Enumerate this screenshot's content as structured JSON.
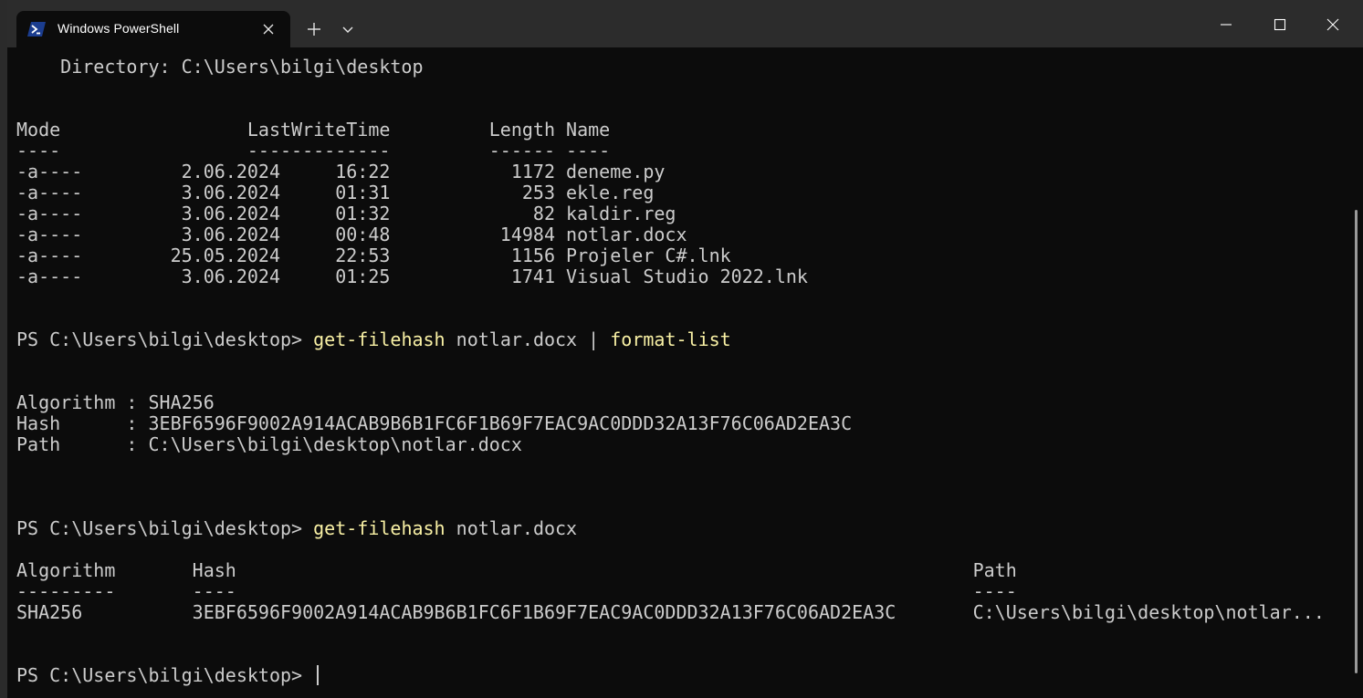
{
  "window": {
    "tab_title": "Windows PowerShell",
    "tab_icon": "powershell-icon",
    "colors": {
      "background": "#0c0c0c",
      "text": "#cccccc",
      "command_highlight": "#f9f1a5",
      "titlebar": "#2c2c2c",
      "icon_blue": "#1b3d8f"
    }
  },
  "terminal": {
    "lines": [
      {
        "t": "    Directory: C:\\Users\\bilgi\\desktop"
      },
      {
        "t": ""
      },
      {
        "t": ""
      },
      {
        "t": "Mode                 LastWriteTime         Length Name"
      },
      {
        "t": "----                 -------------         ------ ----"
      },
      {
        "t": "-a----         2.06.2024     16:22           1172 deneme.py"
      },
      {
        "t": "-a----         3.06.2024     01:31            253 ekle.reg"
      },
      {
        "t": "-a----         3.06.2024     01:32             82 kaldir.reg"
      },
      {
        "t": "-a----         3.06.2024     00:48          14984 notlar.docx"
      },
      {
        "t": "-a----        25.05.2024     22:53           1156 Projeler C#.lnk"
      },
      {
        "t": "-a----         3.06.2024     01:25           1741 Visual Studio 2022.lnk"
      },
      {
        "t": ""
      },
      {
        "t": ""
      },
      {
        "prompt": "PS C:\\Users\\bilgi\\desktop> ",
        "c1": "get-filehash",
        "a1": " notlar.docx | ",
        "c2": "format-list"
      },
      {
        "t": ""
      },
      {
        "t": ""
      },
      {
        "t": "Algorithm : SHA256"
      },
      {
        "t": "Hash      : 3EBF6596F9002A914ACAB9B6B1FC6F1B69F7EAC9AC0DDD32A13F76C06AD2EA3C"
      },
      {
        "t": "Path      : C:\\Users\\bilgi\\desktop\\notlar.docx"
      },
      {
        "t": ""
      },
      {
        "t": ""
      },
      {
        "t": ""
      },
      {
        "prompt": "PS C:\\Users\\bilgi\\desktop> ",
        "c1": "get-filehash",
        "a1": " notlar.docx",
        "c2": ""
      },
      {
        "t": ""
      },
      {
        "t": "Algorithm       Hash                                                                   Path"
      },
      {
        "t": "---------       ----                                                                   ----"
      },
      {
        "t": "SHA256          3EBF6596F9002A914ACAB9B6B1FC6F1B69F7EAC9AC0DDD32A13F76C06AD2EA3C       C:\\Users\\bilgi\\desktop\\notlar..."
      },
      {
        "t": ""
      },
      {
        "t": ""
      },
      {
        "prompt": "PS C:\\Users\\bilgi\\desktop> ",
        "c1": "",
        "a1": "",
        "c2": "",
        "cursor": true
      }
    ]
  }
}
